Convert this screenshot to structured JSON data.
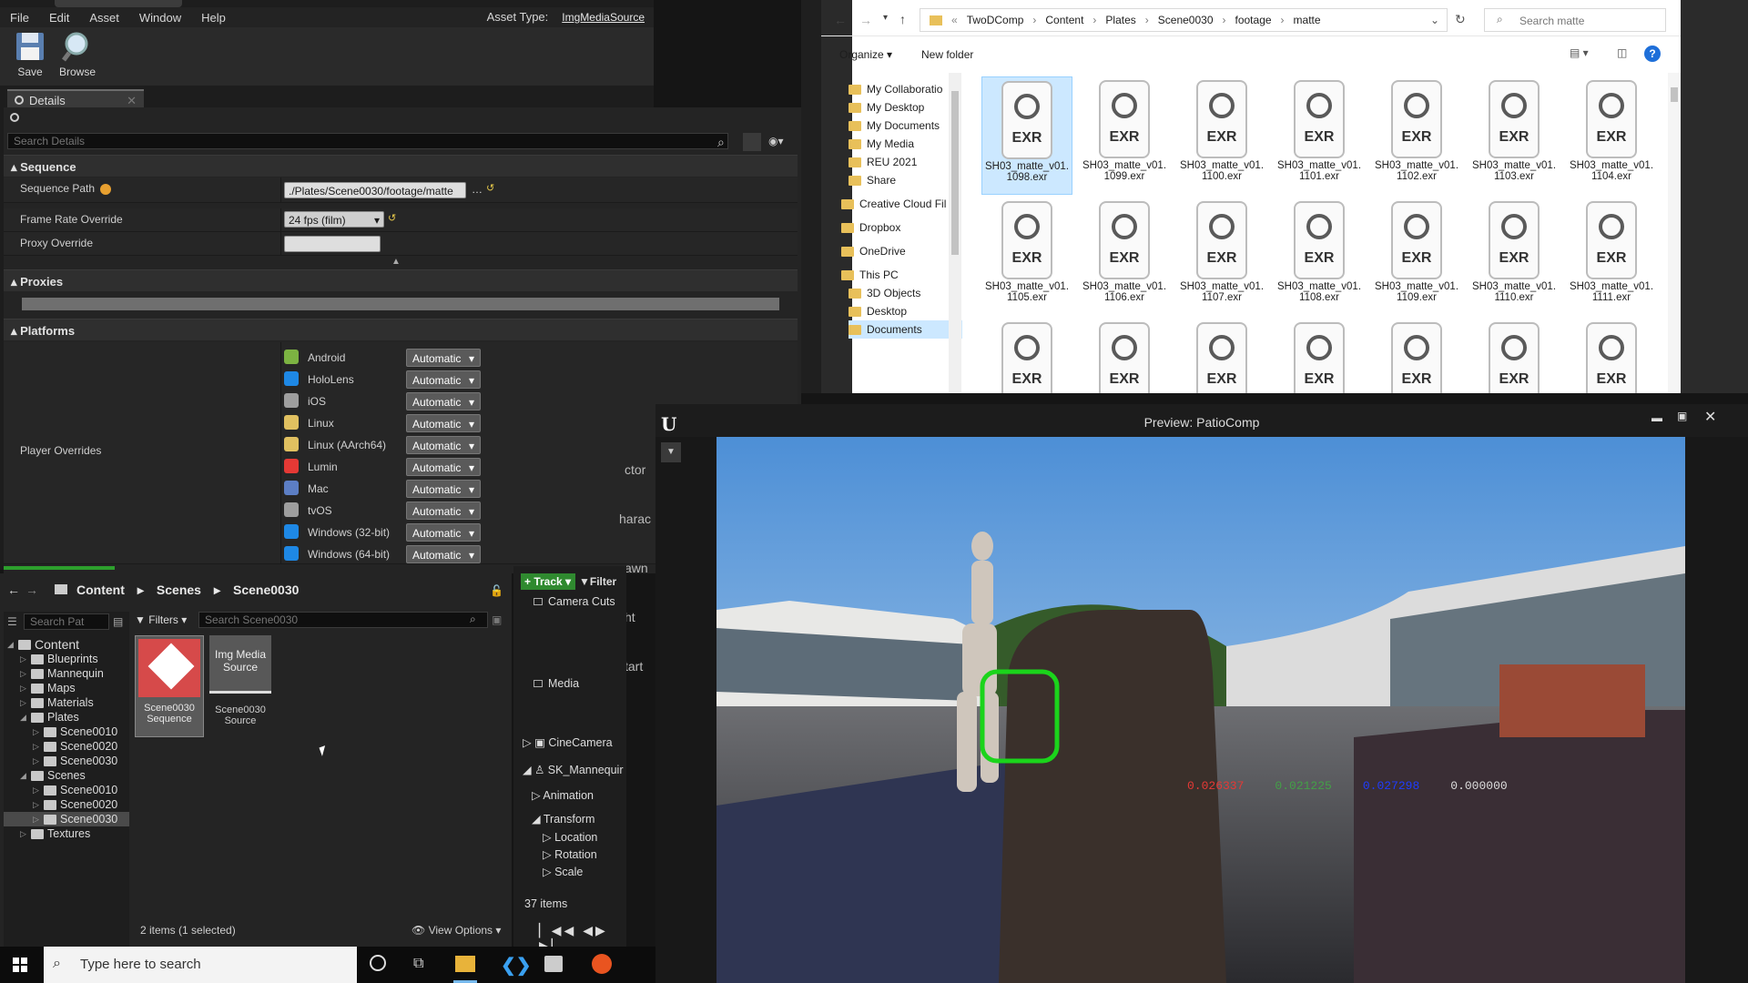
{
  "asset_editor": {
    "menu": [
      "File",
      "Edit",
      "Asset",
      "Window",
      "Help"
    ],
    "asset_type_label": "Asset Type:",
    "asset_type_value": "ImgMediaSource",
    "toolbar": {
      "save": "Save",
      "browse": "Browse"
    },
    "details_tab": "Details",
    "search_placeholder": "Search Details",
    "sections": {
      "sequence": "Sequence",
      "proxies": "Proxies",
      "platforms": "Platforms"
    },
    "props": {
      "sequence_path_label": "Sequence Path",
      "sequence_path_value": "./Plates/Scene0030/footage/matte",
      "frame_rate_label": "Frame Rate Override",
      "frame_rate_value": "24 fps (film)",
      "proxy_label": "Proxy Override",
      "player_overrides_label": "Player Overrides"
    },
    "platforms": [
      {
        "name": "Android",
        "value": "Automatic",
        "color": "#7cb342"
      },
      {
        "name": "HoloLens",
        "value": "Automatic",
        "color": "#1e88e5"
      },
      {
        "name": "iOS",
        "value": "Automatic",
        "color": "#9e9e9e"
      },
      {
        "name": "Linux",
        "value": "Automatic",
        "color": "#e0c060"
      },
      {
        "name": "Linux (AArch64)",
        "value": "Automatic",
        "color": "#e0c060"
      },
      {
        "name": "Lumin",
        "value": "Automatic",
        "color": "#e53935"
      },
      {
        "name": "Mac",
        "value": "Automatic",
        "color": "#5c7ec4"
      },
      {
        "name": "tvOS",
        "value": "Automatic",
        "color": "#9e9e9e"
      },
      {
        "name": "Windows (32-bit)",
        "value": "Automatic",
        "color": "#1e88e5"
      },
      {
        "name": "Windows (64-bit)",
        "value": "Automatic",
        "color": "#1e88e5"
      }
    ]
  },
  "explorer": {
    "breadcrumb": [
      "TwoDComp",
      "Content",
      "Plates",
      "Scene0030",
      "footage",
      "matte"
    ],
    "search_placeholder": "Search matte",
    "organize": "Organize",
    "new_folder": "New folder",
    "nav_items": [
      "My Collaboratio",
      "My Desktop",
      "My Documents",
      "My Media",
      "REU 2021",
      "Share",
      "Creative Cloud Fil",
      "Dropbox",
      "OneDrive",
      "This PC",
      "3D Objects",
      "Desktop",
      "Documents"
    ],
    "files": [
      "SH03_matte_v01.\n1098.exr",
      "SH03_matte_v01.\n1099.exr",
      "SH03_matte_v01.\n1100.exr",
      "SH03_matte_v01.\n1101.exr",
      "SH03_matte_v01.\n1102.exr",
      "SH03_matte_v01.\n1103.exr",
      "SH03_matte_v01.\n1104.exr",
      "SH03_matte_v01.\n1105.exr",
      "SH03_matte_v01.\n1106.exr",
      "SH03_matte_v01.\n1107.exr",
      "SH03_matte_v01.\n1108.exr",
      "SH03_matte_v01.\n1109.exr",
      "SH03_matte_v01.\n1110.exr",
      "SH03_matte_v01.\n1111.exr",
      "",
      "",
      "",
      "",
      "",
      "",
      ""
    ],
    "exr_label": "EXR"
  },
  "content_browser": {
    "path": [
      "Content",
      "Scenes",
      "Scene0030"
    ],
    "search_paths_placeholder": "Search Pat",
    "filters": "Filters",
    "search_placeholder": "Search Scene0030",
    "tree": [
      {
        "label": "Content",
        "depth": 0,
        "open": true
      },
      {
        "label": "Blueprints",
        "depth": 1
      },
      {
        "label": "Mannequin",
        "depth": 1
      },
      {
        "label": "Maps",
        "depth": 1
      },
      {
        "label": "Materials",
        "depth": 1
      },
      {
        "label": "Plates",
        "depth": 1,
        "open": true
      },
      {
        "label": "Scene0010",
        "depth": 2
      },
      {
        "label": "Scene0020",
        "depth": 2
      },
      {
        "label": "Scene0030",
        "depth": 2
      },
      {
        "label": "Scenes",
        "depth": 1,
        "open": true
      },
      {
        "label": "Scene0010",
        "depth": 2
      },
      {
        "label": "Scene0020",
        "depth": 2
      },
      {
        "label": "Scene0030",
        "depth": 2,
        "selected": true
      },
      {
        "label": "Textures",
        "depth": 1
      }
    ],
    "assets": [
      {
        "thumb": "",
        "name": "Scene0030\nSequence"
      },
      {
        "thumb": "Img Media\nSource",
        "name": "Scene0030\nSource"
      }
    ],
    "status": "2 items (1 selected)",
    "view_options": "View Options"
  },
  "sequencer": {
    "track_button": "Track",
    "filter_button": "Filter",
    "tracks": [
      "Camera Cuts",
      "Media",
      "CineCamera",
      "SK_Mannequir",
      "Animation",
      "Transform",
      "Location",
      "Rotation",
      "Scale"
    ],
    "items": "37 items"
  },
  "background_partial": [
    "ctor",
    "harac",
    "awn",
    "ht",
    "tart"
  ],
  "preview": {
    "title": "Preview: PatioComp",
    "pixel": [
      "0.026337",
      "0.021225",
      "0.027298",
      "0.000000"
    ],
    "pixel_colors": [
      "#e53935",
      "#43a047",
      "#1e3cff",
      "#dddddd"
    ]
  },
  "taskbar": {
    "search_placeholder": "Type here to search"
  }
}
